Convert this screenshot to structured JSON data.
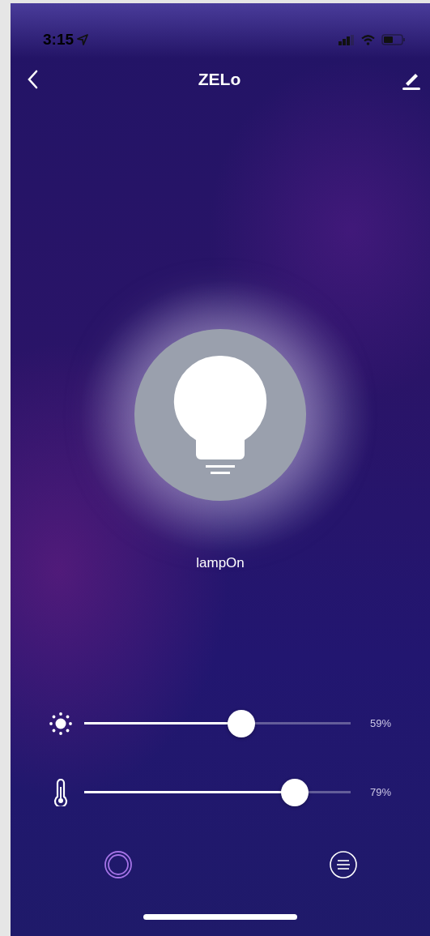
{
  "status_bar": {
    "time": "3:15"
  },
  "header": {
    "title": "ZELo"
  },
  "lamp": {
    "label": "lampOn",
    "on": true
  },
  "sliders": [
    {
      "kind": "brightness",
      "level": 0.59,
      "reading": "59%"
    },
    {
      "kind": "temperature",
      "level": 0.79,
      "reading": "79%"
    }
  ],
  "tabs": [
    {
      "kind": "lamp",
      "selected": true
    },
    {
      "kind": "menu",
      "selected": false
    }
  ]
}
